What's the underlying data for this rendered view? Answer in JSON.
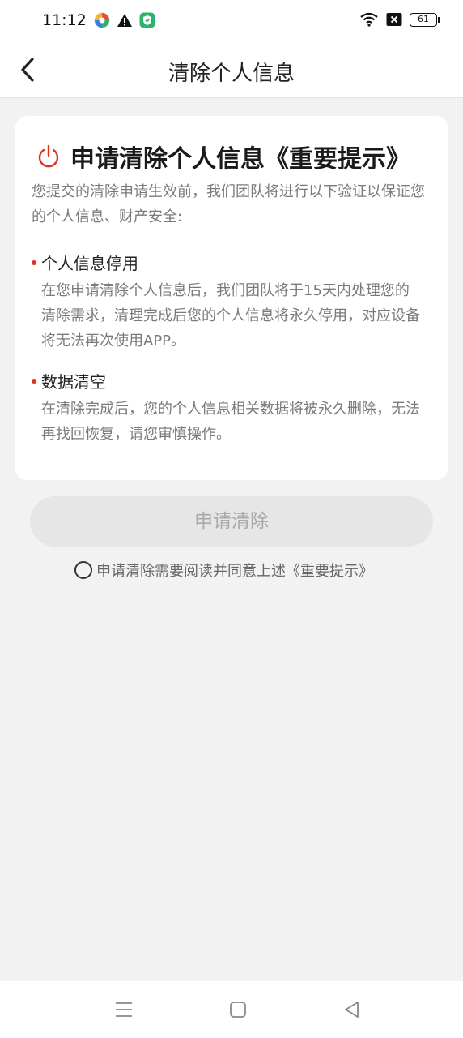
{
  "status_bar": {
    "time": "11:12",
    "battery": "61",
    "icons_left": [
      "colorful-app-icon",
      "warning-icon",
      "shield-app-icon"
    ],
    "icons_right": [
      "wifi-icon",
      "sim-off-icon",
      "battery-icon"
    ]
  },
  "header": {
    "title": "清除个人信息",
    "back_icon": "chevron-left-icon"
  },
  "notice": {
    "icon": "power-icon",
    "title": "申请清除个人信息《重要提示》",
    "intro": "您提交的清除申请生效前，我们团队将进行以下验证以保证您的个人信息、财产安全:",
    "sections": [
      {
        "title": "个人信息停用",
        "body": "在您申请清除个人信息后，我们团队将于15天内处理您的清除需求，清理完成后您的个人信息将永久停用，对应设备将无法再次使用APP。"
      },
      {
        "title": "数据清空",
        "body": "在清除完成后，您的个人信息相关数据将被永久删除，无法再找回恢复，请您审慎操作。"
      }
    ]
  },
  "actions": {
    "apply_label": "申请清除",
    "agree_text": "申请清除需要阅读并同意上述《重要提示》"
  },
  "nav_bar": {
    "icons": [
      "menu-icon",
      "home-icon",
      "back-triangle-icon"
    ]
  },
  "colors": {
    "accent": "#e0301e",
    "background": "#f2f2f2",
    "button_disabled": "#e6e6e6"
  }
}
